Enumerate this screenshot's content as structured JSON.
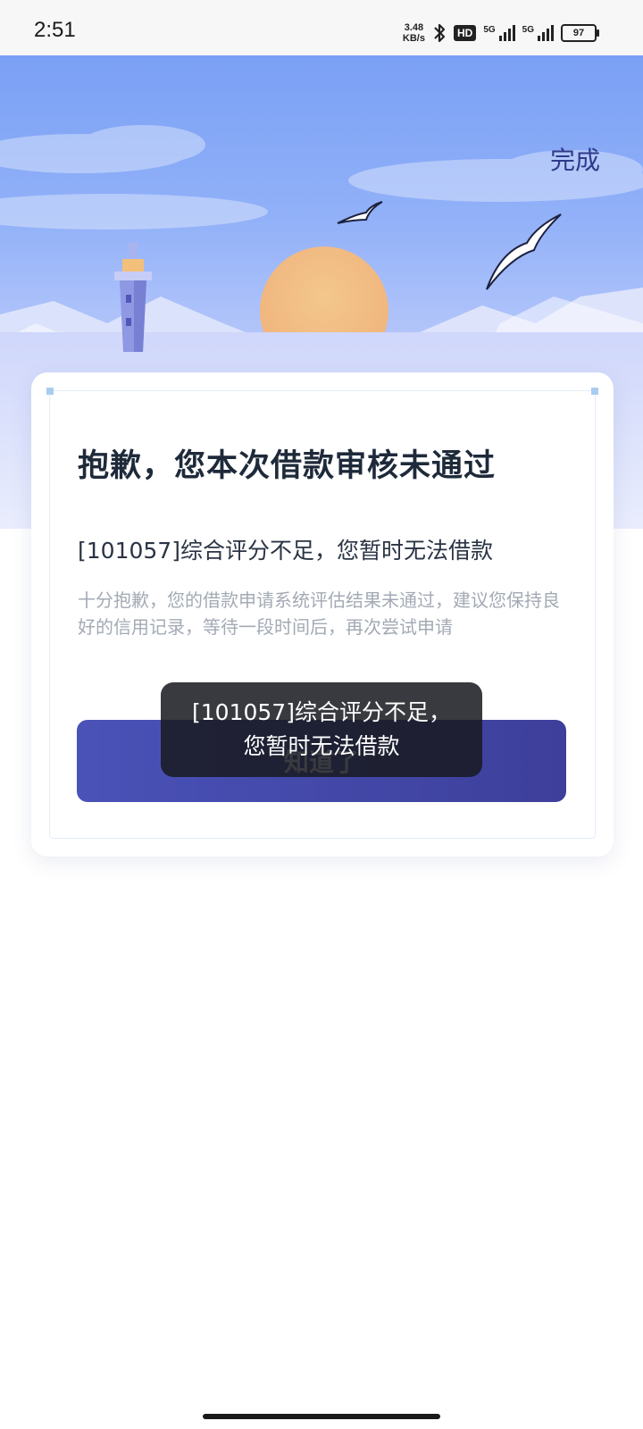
{
  "status_bar": {
    "time": "2:51",
    "net_speed_value": "3.48",
    "net_speed_unit": "KB/s",
    "hd_label": "HD",
    "sim1_label": "5G",
    "sim2_label": "5G",
    "battery_level": "97"
  },
  "header": {
    "done_label": "完成"
  },
  "card": {
    "title": "抱歉，您本次借款审核未通过",
    "reason": "[101057]综合评分不足，您暂时无法借款",
    "description": "十分抱歉，您的借款申请系统评估结果未通过，建议您保持良好的信用记录，等待一段时间后，再次尝试申请",
    "confirm_label": "知道了"
  },
  "toast": {
    "line1": "[101057]综合评分不足，",
    "line2": "您暂时无法借款"
  },
  "colors": {
    "accent": "#3f46a6",
    "title_text": "#1e2a3a",
    "muted_text": "#a3aab4"
  }
}
